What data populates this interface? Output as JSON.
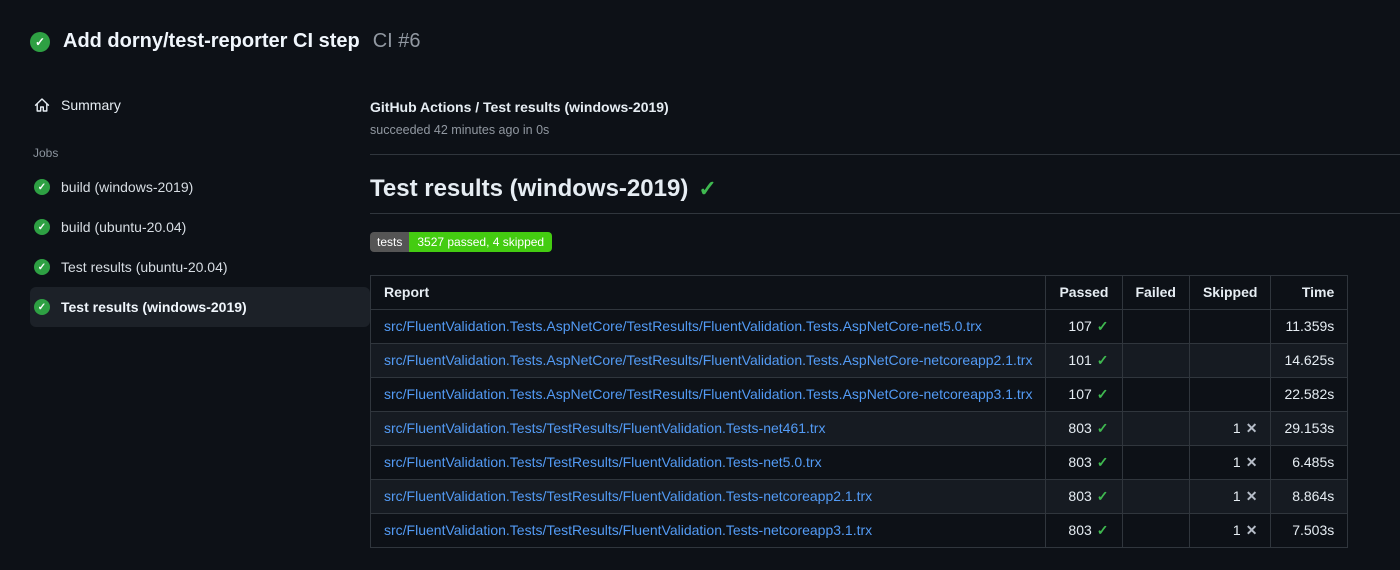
{
  "glyphs": {
    "check": "✓",
    "cross": "✕"
  },
  "colors": {
    "success_green": "#2ea043",
    "check_green": "#3fb950",
    "link_blue": "#539bf5",
    "badge_gray": "#555555",
    "badge_green": "#44cc11"
  },
  "header": {
    "title": "Add dorny/test-reporter CI step",
    "run_number": "CI #6"
  },
  "sidebar": {
    "summary_label": "Summary",
    "jobs_label": "Jobs",
    "jobs": [
      {
        "label": "build (windows-2019)",
        "selected": false
      },
      {
        "label": "build (ubuntu-20.04)",
        "selected": false
      },
      {
        "label": "Test results (ubuntu-20.04)",
        "selected": false
      },
      {
        "label": "Test results (windows-2019)",
        "selected": true
      }
    ]
  },
  "main": {
    "job_title": "GitHub Actions / Test results (windows-2019)",
    "job_status": "succeeded 42 minutes ago in 0s",
    "section_title": "Test results (windows-2019)",
    "badge": {
      "label": "tests",
      "value": "3527 passed, 4 skipped"
    },
    "table": {
      "columns": [
        "Report",
        "Passed",
        "Failed",
        "Skipped",
        "Time"
      ],
      "rows": [
        {
          "report": "src/FluentValidation.Tests.AspNetCore/TestResults/FluentValidation.Tests.AspNetCore-net5.0.trx",
          "passed": "107",
          "failed": "",
          "skipped": "",
          "time": "11.359s"
        },
        {
          "report": "src/FluentValidation.Tests.AspNetCore/TestResults/FluentValidation.Tests.AspNetCore-netcoreapp2.1.trx",
          "passed": "101",
          "failed": "",
          "skipped": "",
          "time": "14.625s"
        },
        {
          "report": "src/FluentValidation.Tests.AspNetCore/TestResults/FluentValidation.Tests.AspNetCore-netcoreapp3.1.trx",
          "passed": "107",
          "failed": "",
          "skipped": "",
          "time": "22.582s"
        },
        {
          "report": "src/FluentValidation.Tests/TestResults/FluentValidation.Tests-net461.trx",
          "passed": "803",
          "failed": "",
          "skipped": "1",
          "time": "29.153s"
        },
        {
          "report": "src/FluentValidation.Tests/TestResults/FluentValidation.Tests-net5.0.trx",
          "passed": "803",
          "failed": "",
          "skipped": "1",
          "time": "6.485s"
        },
        {
          "report": "src/FluentValidation.Tests/TestResults/FluentValidation.Tests-netcoreapp2.1.trx",
          "passed": "803",
          "failed": "",
          "skipped": "1",
          "time": "8.864s"
        },
        {
          "report": "src/FluentValidation.Tests/TestResults/FluentValidation.Tests-netcoreapp3.1.trx",
          "passed": "803",
          "failed": "",
          "skipped": "1",
          "time": "7.503s"
        }
      ]
    }
  }
}
